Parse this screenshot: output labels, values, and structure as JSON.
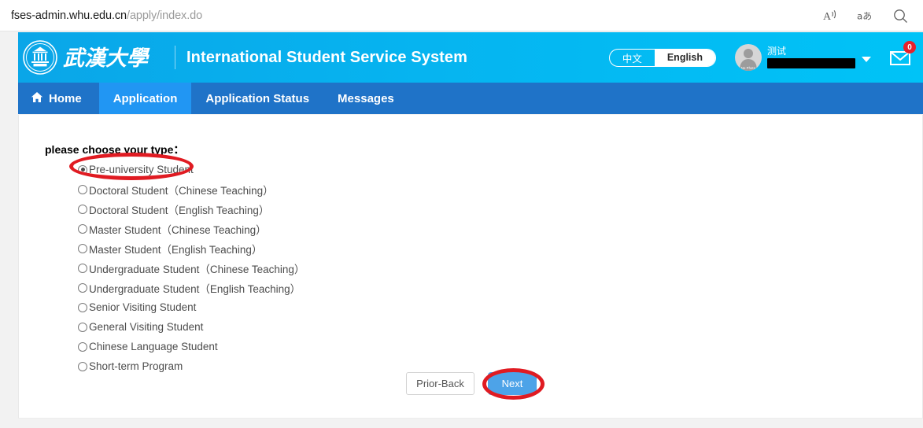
{
  "browser": {
    "url_host": "fses-admin.whu.edu.cn",
    "url_path": "/apply/index.do",
    "actions": [
      {
        "name": "read-aloud-icon",
        "glyph": "A"
      },
      {
        "name": "translate-icon",
        "glyph": "aあ"
      },
      {
        "name": "find-on-page-icon",
        "glyph": "search"
      }
    ]
  },
  "header": {
    "brand_cn": "武汉大学",
    "title": "International Student Service System",
    "language": {
      "chinese_label": "中文",
      "english_label": "English",
      "selected": "English"
    },
    "user": {
      "name": "测试",
      "avatar_caption": "No Photo"
    },
    "messages": {
      "count": "0"
    }
  },
  "nav": {
    "items": [
      {
        "label": "Home",
        "icon": "home-icon",
        "active": false
      },
      {
        "label": "Application",
        "icon": "",
        "active": true
      },
      {
        "label": "Application Status",
        "icon": "",
        "active": false
      },
      {
        "label": "Messages",
        "icon": "",
        "active": false
      }
    ]
  },
  "main": {
    "prompt": "please choose your type：",
    "options": [
      {
        "label": "Pre-university Student",
        "checked": true
      },
      {
        "label": "Doctoral Student（Chinese Teaching）",
        "checked": false
      },
      {
        "label": "Doctoral Student（English Teaching）",
        "checked": false
      },
      {
        "label": "Master Student（Chinese Teaching）",
        "checked": false
      },
      {
        "label": "Master Student（English Teaching）",
        "checked": false
      },
      {
        "label": "Undergraduate Student（Chinese Teaching）",
        "checked": false
      },
      {
        "label": "Undergraduate Student（English Teaching）",
        "checked": false
      },
      {
        "label": "Senior Visiting Student",
        "checked": false
      },
      {
        "label": "General Visiting Student",
        "checked": false
      },
      {
        "label": "Chinese Language Student",
        "checked": false
      },
      {
        "label": "Short-term Program",
        "checked": false
      }
    ],
    "buttons": {
      "prior_label": "Prior-Back",
      "next_label": "Next"
    }
  },
  "annotations": {
    "color": "#e01b22",
    "shapes": [
      {
        "name": "highlight-ellipse-selected-option"
      },
      {
        "name": "highlight-ellipse-next-button"
      }
    ]
  }
}
